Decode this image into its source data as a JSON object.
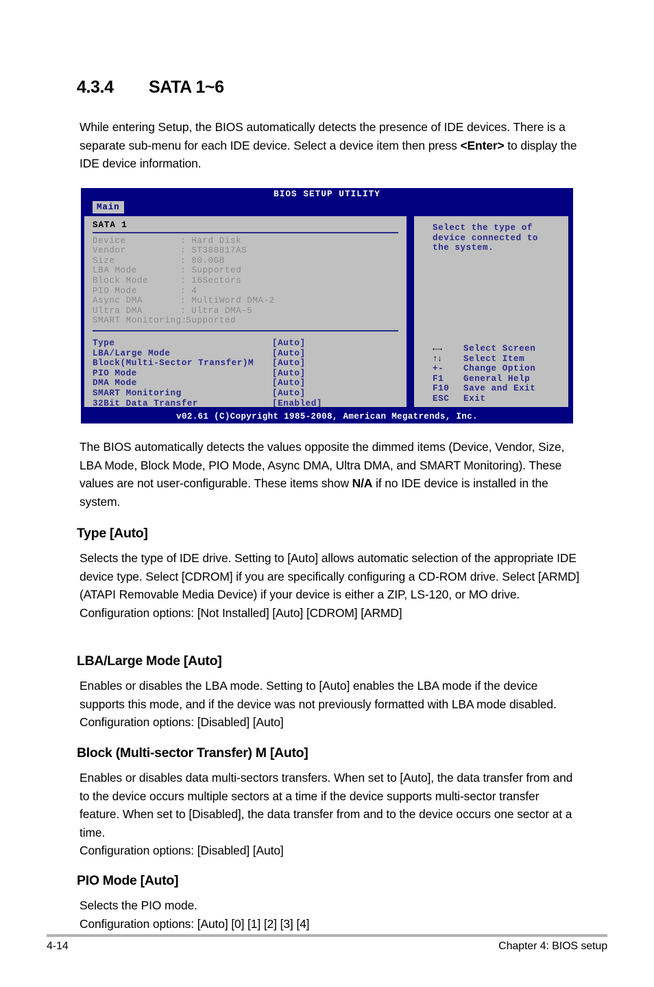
{
  "section": {
    "number": "4.3.4",
    "title": "SATA 1~6"
  },
  "intro_paragraph": "While entering Setup, the BIOS automatically detects the presence of IDE devices. There is a separate sub-menu for each IDE device. Select a device item then press ",
  "intro_bold": "<Enter>",
  "intro_paragraph_end": " to display the IDE device information.",
  "bios": {
    "title": "BIOS SETUP UTILITY",
    "tab": "Main",
    "panel_heading": "SATA 1",
    "info_rows": [
      {
        "label": "Device",
        "sep": ":",
        "value": "Hard Disk"
      },
      {
        "label": "Vendor",
        "sep": ":",
        "value": "ST380817AS"
      },
      {
        "label": "Size",
        "sep": ":",
        "value": "80.0GB"
      },
      {
        "label": "LBA Mode",
        "sep": ":",
        "value": "Supported"
      },
      {
        "label": "Block Mode",
        "sep": ":",
        "value": "16Sectors"
      },
      {
        "label": "PIO Mode",
        "sep": ":",
        "value": "4"
      },
      {
        "label": "Async DMA",
        "sep": ":",
        "value": "MultiWord DMA-2"
      },
      {
        "label": "Ultra DMA",
        "sep": ":",
        "value": "Ultra DMA-5"
      },
      {
        "label": "SMART Monitoring:",
        "sep": "",
        "value": "Supported"
      }
    ],
    "option_rows": [
      {
        "label": "Type",
        "value": "[Auto]"
      },
      {
        "label": "LBA/Large Mode",
        "value": "[Auto]"
      },
      {
        "label": "Block(Multi-Sector Transfer)M",
        "value": "[Auto]"
      },
      {
        "label": "PIO Mode",
        "value": "[Auto]"
      },
      {
        "label": "DMA Mode",
        "value": "[Auto]"
      },
      {
        "label": "SMART Monitoring",
        "value": "[Auto]"
      },
      {
        "label": "32Bit Data Transfer",
        "value": "[Enabled]"
      }
    ],
    "help_lines": [
      "Select the type of",
      "device connected to",
      "the system."
    ],
    "keys": [
      {
        "key": "←→",
        "desc": "Select Screen",
        "glyph": true
      },
      {
        "key": "↑↓",
        "desc": "Select Item",
        "glyph": true
      },
      {
        "key": "+-",
        "desc": "Change Option",
        "glyph": false
      },
      {
        "key": "F1",
        "desc": "General Help",
        "glyph": false
      },
      {
        "key": "F10",
        "desc": "Save and Exit",
        "glyph": false
      },
      {
        "key": "ESC",
        "desc": "Exit",
        "glyph": false
      }
    ],
    "footer": "v02.61 (C)Copyright 1985-2008, American Megatrends, Inc."
  },
  "after_bios_paragraph": "The BIOS automatically detects the values opposite the dimmed items (Device, Vendor, Size, LBA Mode, Block Mode, PIO Mode, Async DMA, Ultra DMA, and SMART Monitoring). These values are not user-configurable. These items show ",
  "after_bios_bold": "N/A",
  "after_bios_paragraph_end": " if no IDE device is installed in the system.",
  "subsections": [
    {
      "heading": "Type [Auto]",
      "body": "Selects the type of IDE drive. Setting to [Auto] allows automatic selection of the appropriate IDE device type. Select [CDROM] if you are specifically configuring a CD-ROM drive. Select [ARMD] (ATAPI Removable Media Device) if your device is either a ZIP, LS-120, or MO drive.",
      "options": "Configuration options: [Not Installed] [Auto] [CDROM] [ARMD]"
    },
    {
      "heading": "LBA/Large Mode [Auto]",
      "body": "Enables or disables the LBA mode. Setting to [Auto] enables the LBA mode if the device supports this mode, and if the device was not previously formatted with LBA mode disabled. Configuration options: [Disabled] [Auto]",
      "options": ""
    },
    {
      "heading": "Block (Multi-sector Transfer) M [Auto]",
      "body": "Enables or disables data multi-sectors transfers. When set to [Auto], the data transfer from and to the device occurs multiple sectors at a time if the device supports multi-sector transfer feature. When set to [Disabled], the data transfer from and to the device occurs one sector at a time.",
      "options": "Configuration options: [Disabled] [Auto]"
    },
    {
      "heading": "PIO Mode [Auto]",
      "body": "Selects the PIO mode.",
      "options": "Configuration options: [Auto] [0] [1] [2] [3] [4]"
    }
  ],
  "page_footer": {
    "page_number": "4-14",
    "chapter": "Chapter 4: BIOS setup"
  }
}
